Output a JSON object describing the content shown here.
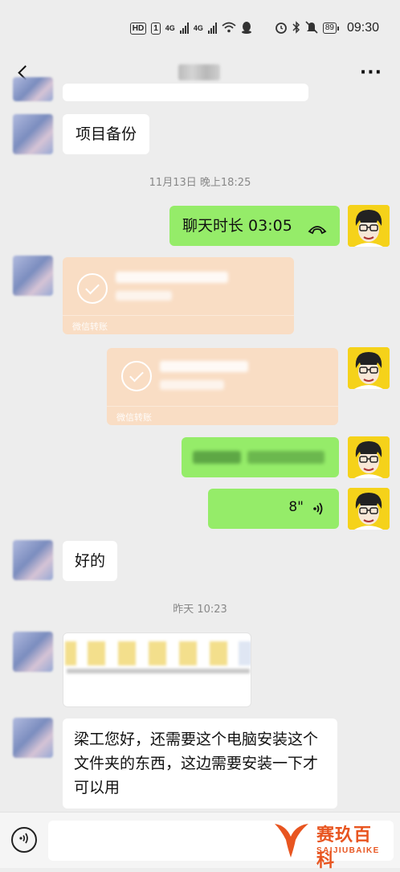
{
  "status_bar": {
    "hd_badge": "HD",
    "sim_badge": "1",
    "net1": "4G",
    "net2": "4G",
    "battery": "89",
    "time": "09:30"
  },
  "header": {
    "back_icon": "chevron-left-icon",
    "more_icon": "more-dots-icon",
    "more_label": "···"
  },
  "messages": {
    "m1_text": "项目备份",
    "time1": "11月13日 晚上18:25",
    "call_label": "聊天时长 03:05",
    "call_icon": "phone-hangup-icon",
    "transfer1_footer": "微信转账",
    "transfer2_footer": "微信转账",
    "voice_duration": "8\"",
    "m_ok": "好的",
    "time2": "昨天 10:23",
    "last_text": "梁工您好，还需要这个电脑安装这个文件夹的东西，这边需要安装一下才可以用"
  },
  "bottom_bar": {
    "voice_icon": "voice-input-icon",
    "watermark_title": "赛玖百科",
    "watermark_sub": "SAIJIUBAIKE"
  },
  "colors": {
    "bg": "#ededed",
    "green_bubble": "#95ec69",
    "transfer_bubble": "#f9ddc4",
    "watermark": "#e85520"
  }
}
